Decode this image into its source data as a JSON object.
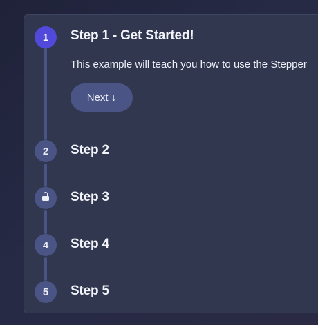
{
  "stepper": {
    "steps": [
      {
        "number": "1",
        "title": "Step 1 - Get Started!",
        "state": "active"
      },
      {
        "number": "2",
        "title": "Step 2",
        "state": "upcoming"
      },
      {
        "number": "",
        "title": "Step 3",
        "state": "locked",
        "icon": "lock-icon"
      },
      {
        "number": "4",
        "title": "Step 4",
        "state": "upcoming"
      },
      {
        "number": "5",
        "title": "Step 5",
        "state": "upcoming"
      }
    ],
    "active_body": "This example will teach you how to use the Stepper",
    "next_label": "Next ↓"
  },
  "colors": {
    "active_accent": "#5149d9",
    "step_circle": "#4b5585",
    "card_background": "#30374f"
  }
}
